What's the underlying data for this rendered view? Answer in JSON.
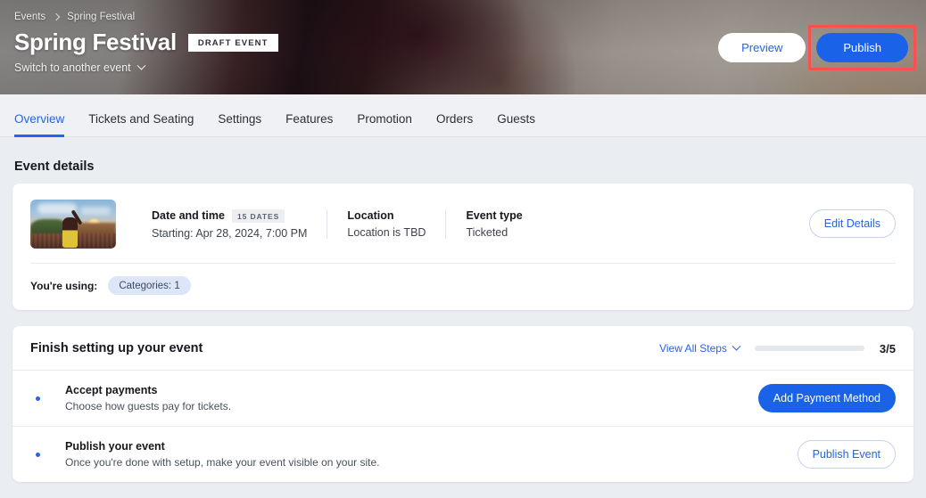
{
  "header": {
    "breadcrumb": [
      {
        "label": "Events"
      },
      {
        "label": "Spring Festival"
      }
    ],
    "title": "Spring Festival",
    "status_badge": "DRAFT EVENT",
    "switch_label": "Switch to another event",
    "preview_label": "Preview",
    "publish_label": "Publish",
    "annotation_color": "#fb5050"
  },
  "tabs": [
    {
      "label": "Overview",
      "active": true
    },
    {
      "label": "Tickets and Seating",
      "active": false
    },
    {
      "label": "Settings",
      "active": false
    },
    {
      "label": "Features",
      "active": false
    },
    {
      "label": "Promotion",
      "active": false
    },
    {
      "label": "Orders",
      "active": false
    },
    {
      "label": "Guests",
      "active": false
    }
  ],
  "event_details": {
    "section_title": "Event details",
    "fields": [
      {
        "label": "Date and time",
        "badge": "15 DATES",
        "value": "Starting: Apr 28, 2024, 7:00 PM"
      },
      {
        "label": "Location",
        "badge": "",
        "value": "Location is TBD"
      },
      {
        "label": "Event type",
        "badge": "",
        "value": "Ticketed"
      }
    ],
    "edit_label": "Edit Details",
    "using_label": "You're using:",
    "using_chips": [
      "Categories: 1"
    ]
  },
  "setup": {
    "title": "Finish setting up your event",
    "view_all_label": "View All Steps",
    "progress_count": "3/5",
    "progress_percent": 60,
    "progress_color": "#1c9a4f",
    "tasks": [
      {
        "title": "Accept payments",
        "description": "Choose how guests pay for tickets.",
        "action": "Add Payment Method",
        "action_style": "primary"
      },
      {
        "title": "Publish your event",
        "description": "Once you're done with setup, make your event visible on your site.",
        "action": "Publish Event",
        "action_style": "outline"
      }
    ]
  }
}
